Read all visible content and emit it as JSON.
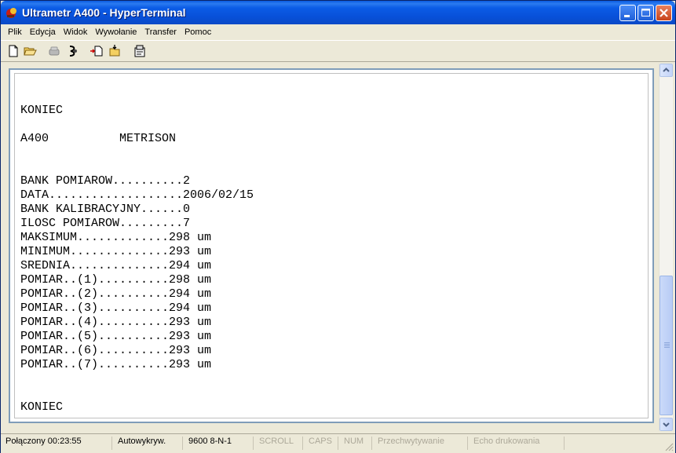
{
  "window": {
    "title": "Ultrametr A400 - HyperTerminal",
    "minimize_label": "Minimize",
    "maximize_label": "Maximize",
    "close_label": "Close"
  },
  "menu": {
    "items": [
      "Plik",
      "Edycja",
      "Widok",
      "Wywołanie",
      "Transfer",
      "Pomoc"
    ]
  },
  "toolbar": {
    "icons": [
      "new-icon",
      "open-icon",
      "connect-icon",
      "disconnect-icon",
      "send-icon",
      "receive-icon",
      "properties-icon"
    ]
  },
  "terminal": {
    "lines": [
      "",
      "KONIEC",
      "",
      "A400          METRISON",
      "",
      "",
      "BANK POMIAROW..........2",
      "DATA...................2006/02/15",
      "BANK KALIBRACYJNY......0",
      "ILOSC POMIAROW.........7",
      "MAKSIMUM.............298 um",
      "MINIMUM..............293 um",
      "SREDNIA..............294 um",
      "POMIAR..(1)..........298 um",
      "POMIAR..(2)..........294 um",
      "POMIAR..(3)..........294 um",
      "POMIAR..(4)..........293 um",
      "POMIAR..(5)..........293 um",
      "POMIAR..(6)..........293 um",
      "POMIAR..(7)..........293 um",
      "",
      "",
      "KONIEC"
    ]
  },
  "status": {
    "connected": "Połączony 00:23:55",
    "autodetect": "Autowykryw.",
    "settings": "9600 8-N-1",
    "scroll": "SCROLL",
    "caps": "CAPS",
    "num": "NUM",
    "capture": "Przechwytywanie",
    "echo": "Echo drukowania"
  },
  "colors": {
    "titlebar": "#0a5ae0",
    "frame": "#ece9d8",
    "terminal_bg": "#ffffff"
  }
}
